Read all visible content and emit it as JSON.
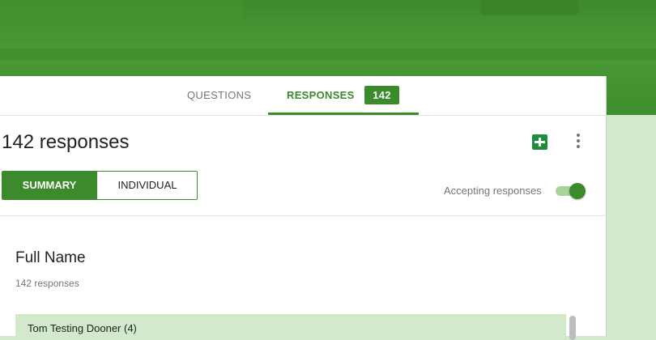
{
  "tabs": {
    "questions": "QUESTIONS",
    "responses": "RESPONSES",
    "responses_count": "142"
  },
  "summary_header": {
    "title": "142 responses",
    "sheets_icon": "google-sheets-icon",
    "more_icon": "more-vert-icon"
  },
  "view_toggle": {
    "summary": "SUMMARY",
    "individual": "INDIVIDUAL",
    "selected": "SUMMARY"
  },
  "accepting": {
    "label": "Accepting responses",
    "enabled": true
  },
  "question": {
    "title": "Full Name",
    "subtitle": "142 responses",
    "answers": [
      "Tom Testing Dooner (4)"
    ]
  },
  "colors": {
    "accent": "#3b8a2b",
    "header_band": "#4a9a38",
    "answer_bg": "#d3e9cc"
  }
}
